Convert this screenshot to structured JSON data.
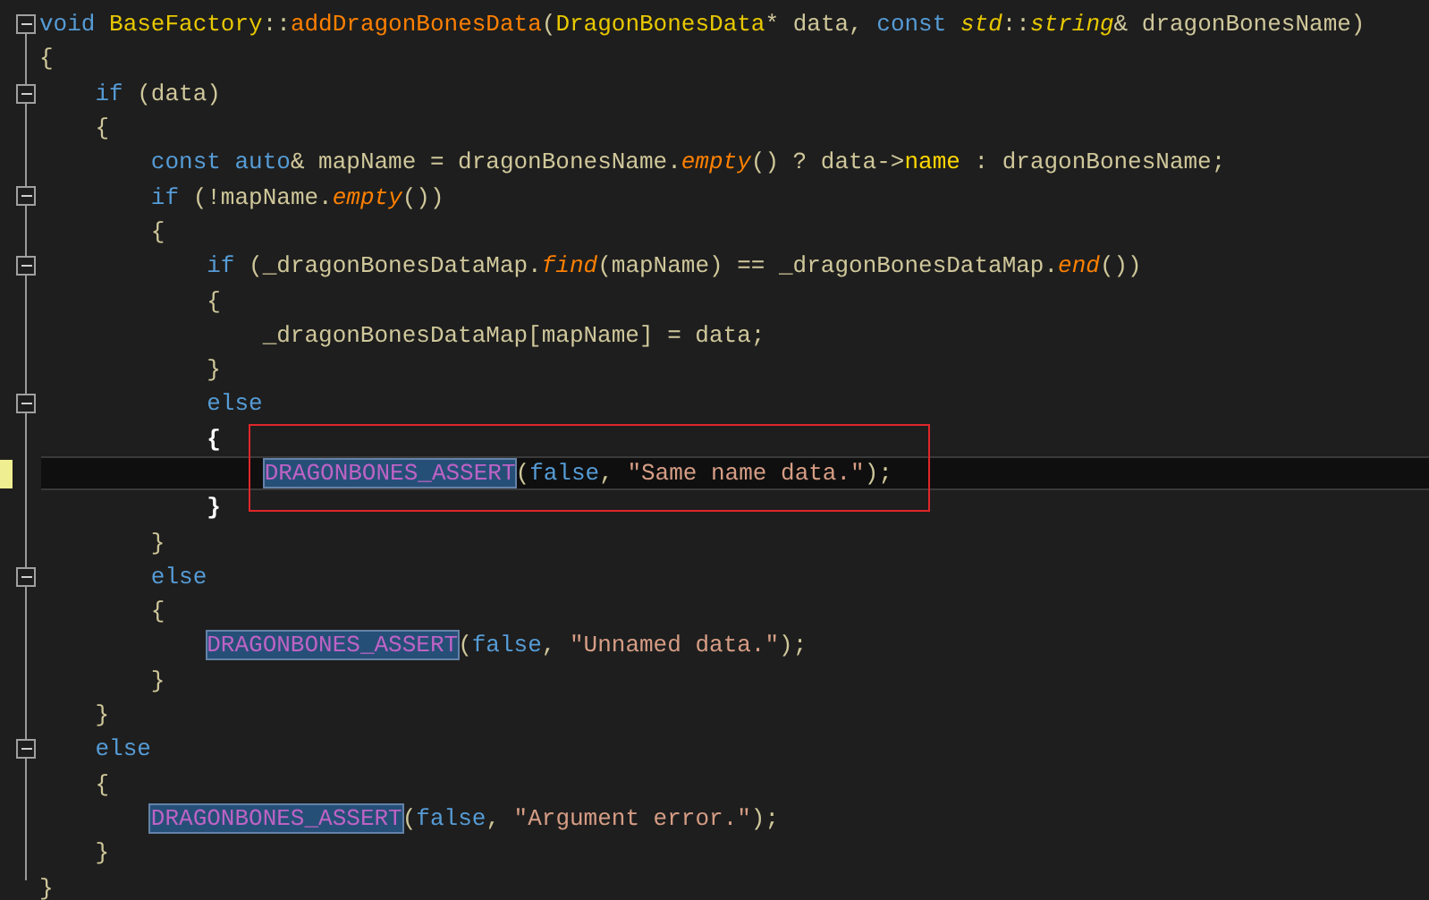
{
  "editor": {
    "lines": [
      {
        "collapsible": true,
        "modified": false,
        "current": false,
        "boxed": false,
        "tokens": [
          {
            "kind": "keyword",
            "text": "void "
          },
          {
            "kind": "type",
            "text": "BaseFactory"
          },
          {
            "kind": "plain",
            "text": "::"
          },
          {
            "kind": "function",
            "text": "addDragonBonesData"
          },
          {
            "kind": "plain",
            "text": "("
          },
          {
            "kind": "type",
            "text": "DragonBonesData"
          },
          {
            "kind": "plain",
            "text": "* data, "
          },
          {
            "kind": "keyword",
            "text": "const "
          },
          {
            "kind": "type-italic",
            "text": "std"
          },
          {
            "kind": "plain",
            "text": "::"
          },
          {
            "kind": "type-italic",
            "text": "string"
          },
          {
            "kind": "plain",
            "text": "& dragonBonesName)"
          }
        ]
      },
      {
        "collapsible": false,
        "modified": false,
        "current": false,
        "boxed": false,
        "tokens": [
          {
            "kind": "plain",
            "text": "{"
          }
        ]
      },
      {
        "collapsible": true,
        "modified": false,
        "current": false,
        "boxed": false,
        "tokens": [
          {
            "kind": "keyword",
            "text": "    if"
          },
          {
            "kind": "plain",
            "text": " (data)"
          }
        ]
      },
      {
        "collapsible": false,
        "modified": false,
        "current": false,
        "boxed": false,
        "tokens": [
          {
            "kind": "plain",
            "text": "    {"
          }
        ]
      },
      {
        "collapsible": false,
        "modified": false,
        "current": false,
        "boxed": false,
        "tokens": [
          {
            "kind": "keyword",
            "text": "        const auto"
          },
          {
            "kind": "plain",
            "text": "& mapName = dragonBonesName."
          },
          {
            "kind": "method",
            "text": "empty"
          },
          {
            "kind": "plain",
            "text": "() ? data->"
          },
          {
            "kind": "member",
            "text": "name"
          },
          {
            "kind": "plain",
            "text": " : dragonBonesName;"
          }
        ]
      },
      {
        "collapsible": true,
        "modified": false,
        "current": false,
        "boxed": false,
        "tokens": [
          {
            "kind": "keyword",
            "text": "        if"
          },
          {
            "kind": "plain",
            "text": " (!mapName."
          },
          {
            "kind": "method",
            "text": "empty"
          },
          {
            "kind": "plain",
            "text": "())"
          }
        ]
      },
      {
        "collapsible": false,
        "modified": false,
        "current": false,
        "boxed": false,
        "tokens": [
          {
            "kind": "plain",
            "text": "        {"
          }
        ]
      },
      {
        "collapsible": true,
        "modified": false,
        "current": false,
        "boxed": false,
        "tokens": [
          {
            "kind": "keyword",
            "text": "            if"
          },
          {
            "kind": "plain",
            "text": " (_dragonBonesDataMap."
          },
          {
            "kind": "method",
            "text": "find"
          },
          {
            "kind": "plain",
            "text": "(mapName) == _dragonBonesDataMap."
          },
          {
            "kind": "method",
            "text": "end"
          },
          {
            "kind": "plain",
            "text": "())"
          }
        ]
      },
      {
        "collapsible": false,
        "modified": false,
        "current": false,
        "boxed": false,
        "tokens": [
          {
            "kind": "plain",
            "text": "            {"
          }
        ]
      },
      {
        "collapsible": false,
        "modified": false,
        "current": false,
        "boxed": false,
        "tokens": [
          {
            "kind": "plain",
            "text": "                _dragonBonesDataMap[mapName] = data;"
          }
        ]
      },
      {
        "collapsible": false,
        "modified": false,
        "current": false,
        "boxed": false,
        "tokens": [
          {
            "kind": "plain",
            "text": "            }"
          }
        ]
      },
      {
        "collapsible": true,
        "modified": false,
        "current": false,
        "boxed": false,
        "tokens": [
          {
            "kind": "keyword",
            "text": "            else"
          }
        ]
      },
      {
        "collapsible": false,
        "modified": false,
        "current": false,
        "boxed": false,
        "tokens": [
          {
            "kind": "brace-match",
            "text": "            {"
          }
        ]
      },
      {
        "collapsible": false,
        "modified": true,
        "current": true,
        "boxed": true,
        "tokens": [
          {
            "kind": "macro",
            "highlighted": true,
            "text": "                DRAGONBONES_ASSERT"
          },
          {
            "kind": "plain",
            "text": "("
          },
          {
            "kind": "keyword",
            "text": "false"
          },
          {
            "kind": "plain",
            "text": ", "
          },
          {
            "kind": "string",
            "text": "\"Same name data.\""
          },
          {
            "kind": "plain",
            "text": ");"
          }
        ]
      },
      {
        "collapsible": false,
        "modified": false,
        "current": false,
        "boxed": false,
        "tokens": [
          {
            "kind": "brace-match",
            "text": "            }"
          }
        ]
      },
      {
        "collapsible": false,
        "modified": false,
        "current": false,
        "boxed": false,
        "tokens": [
          {
            "kind": "plain",
            "text": "        }"
          }
        ]
      },
      {
        "collapsible": true,
        "modified": false,
        "current": false,
        "boxed": false,
        "tokens": [
          {
            "kind": "keyword",
            "text": "        else"
          }
        ]
      },
      {
        "collapsible": false,
        "modified": false,
        "current": false,
        "boxed": false,
        "tokens": [
          {
            "kind": "plain",
            "text": "        {"
          }
        ]
      },
      {
        "collapsible": false,
        "modified": false,
        "current": false,
        "boxed": false,
        "tokens": [
          {
            "kind": "macro",
            "highlighted": true,
            "text": "            DRAGONBONES_ASSERT"
          },
          {
            "kind": "plain",
            "text": "("
          },
          {
            "kind": "keyword",
            "text": "false"
          },
          {
            "kind": "plain",
            "text": ", "
          },
          {
            "kind": "string",
            "text": "\"Unnamed data.\""
          },
          {
            "kind": "plain",
            "text": ");"
          }
        ]
      },
      {
        "collapsible": false,
        "modified": false,
        "current": false,
        "boxed": false,
        "tokens": [
          {
            "kind": "plain",
            "text": "        }"
          }
        ]
      },
      {
        "collapsible": false,
        "modified": false,
        "current": false,
        "boxed": false,
        "tokens": [
          {
            "kind": "plain",
            "text": "    }"
          }
        ]
      },
      {
        "collapsible": true,
        "modified": false,
        "current": false,
        "boxed": false,
        "tokens": [
          {
            "kind": "keyword",
            "text": "    else"
          }
        ]
      },
      {
        "collapsible": false,
        "modified": false,
        "current": false,
        "boxed": false,
        "tokens": [
          {
            "kind": "plain",
            "text": "    {"
          }
        ]
      },
      {
        "collapsible": false,
        "modified": false,
        "current": false,
        "boxed": false,
        "tokens": [
          {
            "kind": "macro",
            "highlighted": true,
            "text": "        DRAGONBONES_ASSERT"
          },
          {
            "kind": "plain",
            "text": "("
          },
          {
            "kind": "keyword",
            "text": "false"
          },
          {
            "kind": "plain",
            "text": ", "
          },
          {
            "kind": "string",
            "text": "\"Argument error.\""
          },
          {
            "kind": "plain",
            "text": ");"
          }
        ]
      },
      {
        "collapsible": false,
        "modified": false,
        "current": false,
        "boxed": false,
        "tokens": [
          {
            "kind": "plain",
            "text": "    }"
          }
        ]
      },
      {
        "collapsible": false,
        "modified": false,
        "current": false,
        "boxed": false,
        "tokens": [
          {
            "kind": "plain",
            "text": "}"
          }
        ]
      }
    ]
  }
}
